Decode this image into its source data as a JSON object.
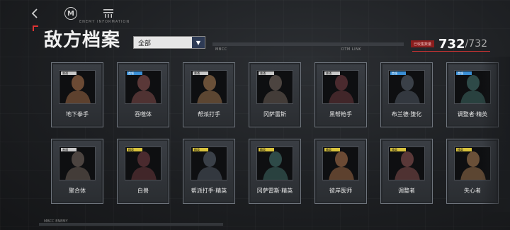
{
  "nav": {
    "back_icon": "back-arrow-icon",
    "logo_icon": "m-logo-icon",
    "logo_letter": "M",
    "menu_icon": "menu-icon"
  },
  "header": {
    "subtitle": "ENEMY INFORMATION",
    "title": "敌方档案",
    "filter_value": "全部",
    "filter_arrow": "▼",
    "hud_left": "MBCC",
    "hud_right": "DTM LINK",
    "counter_tag": "已收集数量",
    "counter_current": "732",
    "counter_total": "/732"
  },
  "footer": {
    "label": "MBCC ENEMY"
  },
  "colors": {
    "accent_red": "#c33333",
    "tag_normal": "#c9c9c9",
    "tag_elite": "#d8c23c",
    "tag_boss": "#3a8fd6"
  },
  "enemies_row1": [
    {
      "name": "地下拳手",
      "tag": "normal",
      "tag_label": "普通"
    },
    {
      "name": "吞噬体",
      "tag": "boss",
      "tag_label": "首领"
    },
    {
      "name": "帮派打手",
      "tag": "normal",
      "tag_label": "普通"
    },
    {
      "name": "冈萨雷斯",
      "tag": "normal",
      "tag_label": "普通"
    },
    {
      "name": "黑帮枪手",
      "tag": "normal",
      "tag_label": "普通"
    },
    {
      "name": "布兰德·堕化",
      "tag": "boss",
      "tag_label": "首领"
    },
    {
      "name": "调整者·精英",
      "tag": "boss",
      "tag_label": "首领"
    }
  ],
  "enemies_row2": [
    {
      "name": "聚合体",
      "tag": "normal",
      "tag_label": "普通"
    },
    {
      "name": "白兽",
      "tag": "elite",
      "tag_label": "精英"
    },
    {
      "name": "帮派打手·精英",
      "tag": "elite",
      "tag_label": "精英"
    },
    {
      "name": "冈萨雷斯·精英",
      "tag": "elite",
      "tag_label": "精英"
    },
    {
      "name": "彼岸医师",
      "tag": "elite",
      "tag_label": "精英"
    },
    {
      "name": "调整者",
      "tag": "elite",
      "tag_label": "精英"
    },
    {
      "name": "失心者",
      "tag": "elite",
      "tag_label": "精英"
    }
  ]
}
